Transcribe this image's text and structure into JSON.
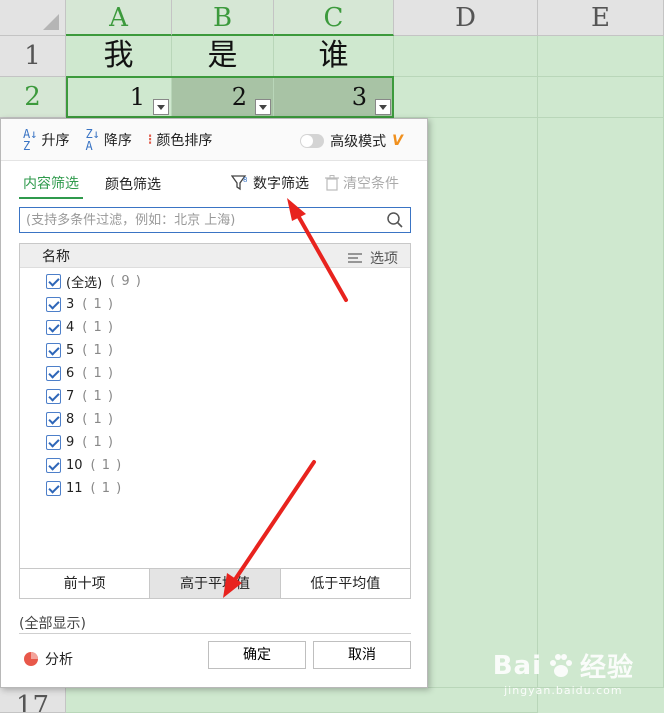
{
  "sheet": {
    "columns": [
      "A",
      "B",
      "C",
      "D",
      "E"
    ],
    "rows": [
      "1",
      "2",
      "17"
    ],
    "row1": [
      "我",
      "是",
      "谁"
    ],
    "row2": [
      "1",
      "2",
      "3"
    ]
  },
  "panel": {
    "sort_asc": "升序",
    "sort_desc": "降序",
    "color_sort": "颜色排序",
    "advanced_mode": "高级模式",
    "tab_content": "内容筛选",
    "tab_color": "颜色筛选",
    "number_filter": "数字筛选",
    "clear_conditions": "清空条件",
    "search_placeholder": "(支持多条件过滤，例如：北京 上海)",
    "list_header": "名称",
    "options_label": "选项",
    "items": [
      {
        "label": "(全选)",
        "count": "( 9 )"
      },
      {
        "label": "3",
        "count": "( 1 )"
      },
      {
        "label": "4",
        "count": "( 1 )"
      },
      {
        "label": "5",
        "count": "( 1 )"
      },
      {
        "label": "6",
        "count": "( 1 )"
      },
      {
        "label": "7",
        "count": "( 1 )"
      },
      {
        "label": "8",
        "count": "( 1 )"
      },
      {
        "label": "9",
        "count": "( 1 )"
      },
      {
        "label": "10",
        "count": "( 1 )"
      },
      {
        "label": "11",
        "count": "( 1 )"
      }
    ],
    "top_ten": "前十项",
    "above_avg": "高于平均值",
    "below_avg": "低于平均值",
    "show_all": "(全部显示)",
    "analyze": "分析",
    "ok": "确定",
    "cancel": "取消"
  },
  "watermark": {
    "brand_left": "Bai",
    "brand_right": "经验",
    "url": "jingyan.baidu.com"
  },
  "colors": {
    "grid_bg": "#cfe8cf",
    "accent_green": "#2f9a4c",
    "arrow_red": "#e8231e"
  }
}
